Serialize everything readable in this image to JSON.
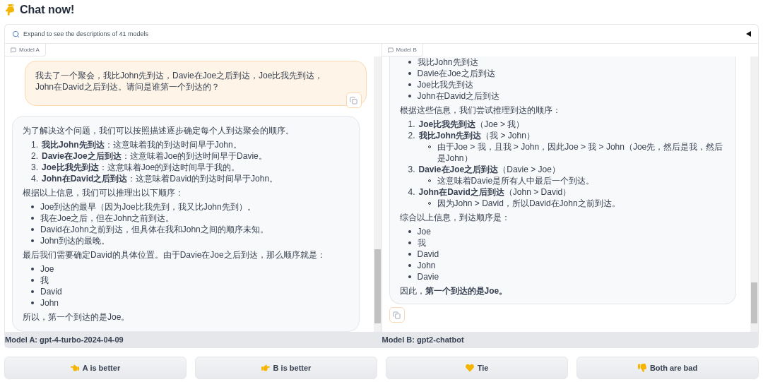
{
  "title": "Chat now!",
  "expander": {
    "label": "Expand to see the descriptions of 41 models",
    "expanded": false
  },
  "panels": [
    {
      "tab": "Model A",
      "model_label": "Model A: gpt-4-turbo-2024-04-09",
      "messages": [
        {
          "kind": "user",
          "blocks": [
            {
              "kind": "p",
              "text": "我去了一个聚会，我比John先到达，Davie在Joe之后到达，Joe比我先到达，John在David之后到达。请问是谁第一个到达的？"
            }
          ]
        },
        {
          "kind": "bot",
          "blocks": [
            {
              "kind": "p",
              "text": "为了解决这个问题，我们可以按照描述逐步确定每个人到达聚会的顺序。"
            },
            {
              "kind": "ol",
              "items": [
                {
                  "marker": "1.",
                  "text": "**我比John先到达**：这意味着我的到达时间早于John。"
                },
                {
                  "marker": "2.",
                  "text": "**Davie在Joe之后到达**：这意味着Joe的到达时间早于Davie。"
                },
                {
                  "marker": "3.",
                  "text": "**Joe比我先到达**：这意味着Joe的到达时间早于我的。"
                },
                {
                  "marker": "4.",
                  "text": "**John在David之后到达**：这意味着David的到达时间早于John。"
                }
              ]
            },
            {
              "kind": "p",
              "text": "根据以上信息，我们可以推理出以下顺序："
            },
            {
              "kind": "ul",
              "items": [
                {
                  "text": "Joe到达的最早（因为Joe比我先到，我又比John先到）。"
                },
                {
                  "text": "我在Joe之后，但在John之前到达。"
                },
                {
                  "text": "David在John之前到达，但具体在我和John之间的顺序未知。"
                },
                {
                  "text": "John到达的最晚。"
                }
              ]
            },
            {
              "kind": "p",
              "text": "最后我们需要确定David的具体位置。由于Davie在Joe之后到达，那么顺序就是："
            },
            {
              "kind": "ul",
              "items": [
                {
                  "text": "Joe"
                },
                {
                  "text": "我"
                },
                {
                  "text": "David"
                },
                {
                  "text": "John"
                }
              ]
            },
            {
              "kind": "p",
              "text": "所以，第一个到达的是Joe。"
            }
          ]
        }
      ]
    },
    {
      "tab": "Model B",
      "model_label": "Model B: gpt2-chatbot",
      "messages": [
        {
          "kind": "bot",
          "blocks": [
            {
              "kind": "ul",
              "items": [
                {
                  "text": "我比John先到达"
                },
                {
                  "text": "Davie在Joe之后到达"
                },
                {
                  "text": "Joe比我先到达"
                },
                {
                  "text": "John在David之后到达"
                }
              ]
            },
            {
              "kind": "p",
              "text": "根据这些信息，我们尝试推理到达的顺序："
            },
            {
              "kind": "ol",
              "items": [
                {
                  "marker": "1.",
                  "text": "**Joe比我先到达**（Joe > 我）"
                },
                {
                  "marker": "2.",
                  "text": "**我比John先到达**（我 > John）",
                  "children": [
                    {
                      "text": "由于Joe > 我，且我 > John，因此Joe > 我 > John（Joe先，然后是我，然后是John）"
                    }
                  ]
                },
                {
                  "marker": "3.",
                  "text": "**Davie在Joe之后到达**（Davie > Joe）",
                  "children": [
                    {
                      "text": "这意味着Davie是所有人中最后一个到达。"
                    }
                  ]
                },
                {
                  "marker": "4.",
                  "text": "**John在David之后到达**（John > David）",
                  "children": [
                    {
                      "text": "因为John > David，所以David在John之前到达。"
                    }
                  ]
                }
              ]
            },
            {
              "kind": "p",
              "text": "综合以上信息，到达顺序是："
            },
            {
              "kind": "ul",
              "items": [
                {
                  "text": "Joe"
                },
                {
                  "text": "我"
                },
                {
                  "text": "David"
                },
                {
                  "text": "John"
                },
                {
                  "text": "Davie"
                }
              ]
            },
            {
              "kind": "p",
              "text": "因此，**第一个到达的是Joe。**"
            }
          ]
        }
      ]
    }
  ],
  "vote_buttons": [
    {
      "label": "A is better",
      "kind": "left"
    },
    {
      "label": "B is better",
      "kind": "right"
    },
    {
      "label": "Tie",
      "kind": "tie"
    },
    {
      "label": "Both are bad",
      "kind": "bad"
    }
  ]
}
